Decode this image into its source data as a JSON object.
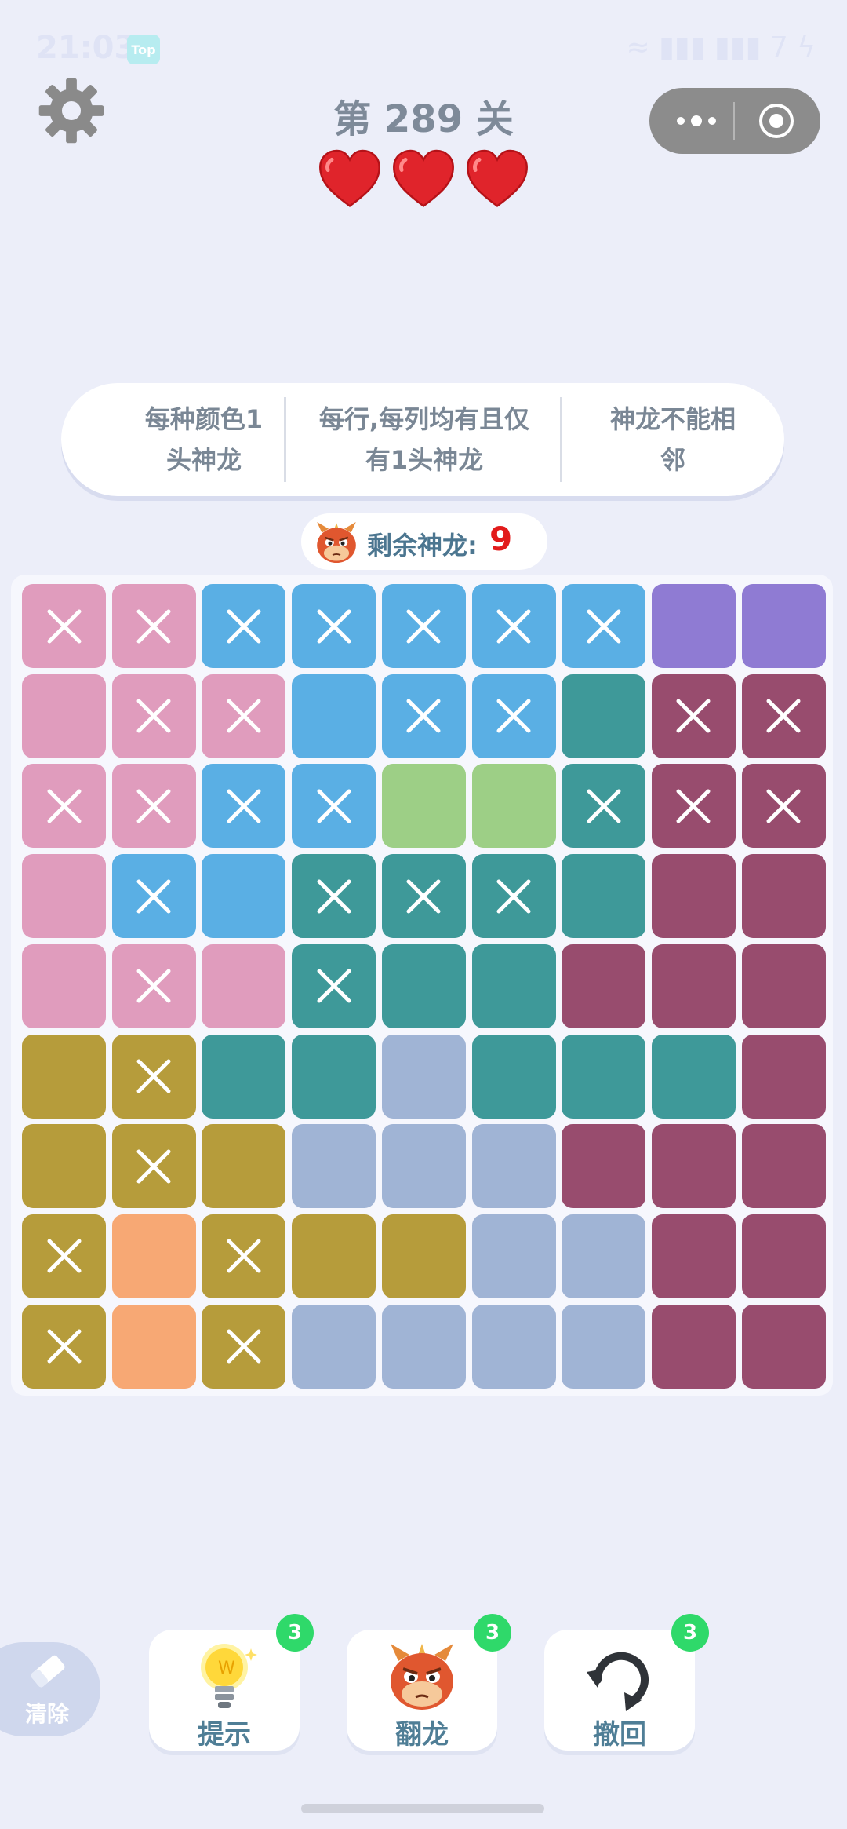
{
  "status_bar": {
    "time": "21:03",
    "top_badge": "Top",
    "battery": "7"
  },
  "header": {
    "level_title": "第 289 关",
    "lives": 3
  },
  "rules": [
    {
      "line1": "每种颜色1",
      "line2": "头神龙"
    },
    {
      "line1": "每行,每列均有且仅",
      "line2": "有1头神龙"
    },
    {
      "line1": "神龙不能相",
      "line2": "邻"
    }
  ],
  "remaining": {
    "label": "剩余神龙:",
    "count": "9"
  },
  "colors": {
    "A": "#e09cbd",
    "B": "#5aafe4",
    "C": "#8f7bd3",
    "D": "#3e9999",
    "E": "#984c6e",
    "F": "#9dcf86",
    "G": "#b69c3b",
    "H": "#a0b4d5",
    "I": "#f7a874"
  },
  "board": {
    "rows": [
      [
        "A",
        "A",
        "B",
        "B",
        "B",
        "B",
        "B",
        "C",
        "C"
      ],
      [
        "A",
        "A",
        "A",
        "B",
        "B",
        "B",
        "D",
        "E",
        "E"
      ],
      [
        "A",
        "A",
        "B",
        "B",
        "F",
        "F",
        "D",
        "E",
        "E"
      ],
      [
        "A",
        "B",
        "B",
        "D",
        "D",
        "D",
        "D",
        "E",
        "E"
      ],
      [
        "A",
        "A",
        "A",
        "D",
        "D",
        "D",
        "E",
        "E",
        "E"
      ],
      [
        "G",
        "G",
        "D",
        "D",
        "H",
        "D",
        "D",
        "D",
        "E"
      ],
      [
        "G",
        "G",
        "G",
        "H",
        "H",
        "H",
        "E",
        "E",
        "E"
      ],
      [
        "G",
        "I",
        "G",
        "G",
        "G",
        "H",
        "H",
        "E",
        "E"
      ],
      [
        "G",
        "I",
        "G",
        "H",
        "H",
        "H",
        "H",
        "E",
        "E"
      ]
    ],
    "marks": [
      [
        1,
        1,
        1,
        1,
        1,
        1,
        1,
        0,
        0
      ],
      [
        0,
        1,
        1,
        0,
        1,
        1,
        0,
        1,
        1
      ],
      [
        1,
        1,
        1,
        1,
        0,
        0,
        1,
        1,
        1
      ],
      [
        0,
        1,
        0,
        1,
        1,
        1,
        0,
        0,
        0
      ],
      [
        0,
        1,
        0,
        1,
        0,
        0,
        0,
        0,
        0
      ],
      [
        0,
        1,
        0,
        0,
        0,
        0,
        0,
        0,
        0
      ],
      [
        0,
        1,
        0,
        0,
        0,
        0,
        0,
        0,
        0
      ],
      [
        1,
        0,
        1,
        0,
        0,
        0,
        0,
        0,
        0
      ],
      [
        1,
        0,
        1,
        0,
        0,
        0,
        0,
        0,
        0
      ]
    ]
  },
  "eraser": {
    "label": "清除",
    "icon": "eraser-icon"
  },
  "tools": [
    {
      "name": "hint",
      "label": "提示",
      "badge": "3",
      "icon": "lightbulb-icon"
    },
    {
      "name": "flip-dragon",
      "label": "翻龙",
      "badge": "3",
      "icon": "dragon-icon"
    },
    {
      "name": "undo",
      "label": "撤回",
      "badge": "3",
      "icon": "undo-icon"
    }
  ]
}
